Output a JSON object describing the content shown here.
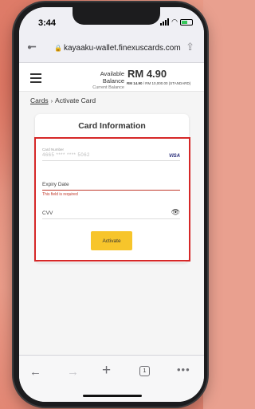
{
  "status": {
    "time": "3:44"
  },
  "browser": {
    "url": "kayaaku-wallet.finexuscards.com",
    "tab_count": "1"
  },
  "header": {
    "available_balance_label": "Available Balance",
    "current_balance_label": "Current Balance",
    "balance_value": "RM 4.90",
    "current_balance_value": "RM 14.90",
    "balance_limit": "/ RM 10,000.00 (STANDARD)"
  },
  "breadcrumb": {
    "cards": "Cards",
    "separator": "›",
    "current": "Activate Card"
  },
  "card_form": {
    "title": "Card Information",
    "card_number_label": "Card Number",
    "card_number_value": "4665 **** **** 5062",
    "card_brand": "VISA",
    "expiry_label": "Expiry Date",
    "expiry_error": "This field is required",
    "cvv_label": "CVV",
    "activate_label": "Activate"
  },
  "colors": {
    "accent_yellow": "#f7c52b",
    "error_red": "#c0392b",
    "highlight_box": "#d62828"
  }
}
